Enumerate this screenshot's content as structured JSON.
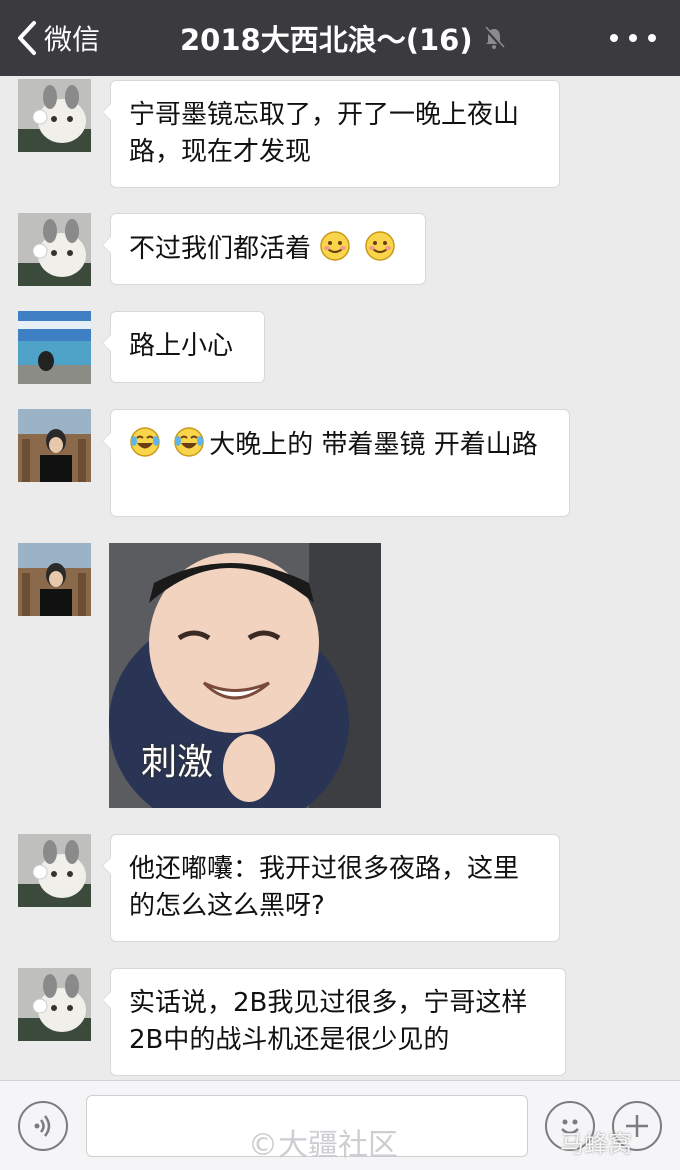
{
  "header": {
    "back_label": "微信",
    "title": "2018大西北浪～(16)",
    "mute_icon": "bell-muted-icon",
    "more_icon": "more-dots-icon",
    "bg_color": "#3a3a3f"
  },
  "messages": [
    {
      "sender": "cat-avatar",
      "text": "宁哥墨镜忘取了，开了一晚上夜山路，现在才发现"
    },
    {
      "sender": "cat-avatar",
      "text": "不过我们都活着",
      "emojis": [
        "smile-emoji",
        "smile-emoji"
      ]
    },
    {
      "sender": "lake-avatar",
      "text": "路上小心"
    },
    {
      "sender": "woman-avatar",
      "text": "大晚上的 带着墨镜 开着山路",
      "emojis": [
        "laugh-tears-emoji",
        "laugh-tears-emoji"
      ]
    },
    {
      "sender": "woman-avatar",
      "sticker_caption": "刺激"
    },
    {
      "sender": "cat-avatar",
      "text": "他还嘟囔：我开过很多夜路，这里的怎么这么黑呀?"
    },
    {
      "sender": "cat-avatar",
      "text": "实话说，2B我见过很多，宁哥这样2B中的战斗机还是很少见的"
    }
  ],
  "input_bar": {
    "voice_icon": "voice-icon",
    "emoji_icon": "emoji-icon",
    "plus_icon": "plus-icon",
    "input_value": ""
  },
  "watermarks": {
    "left": "©大疆社区",
    "right": "马蜂窝"
  }
}
